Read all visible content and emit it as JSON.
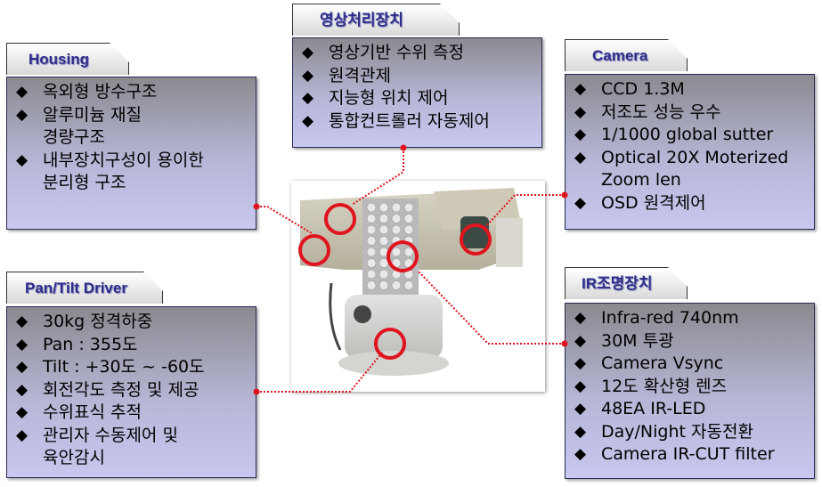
{
  "sections": {
    "housing": {
      "title": "Housing",
      "items": [
        "옥외형 방수구조",
        "알루미늄 재질\n경량구조",
        "내부장치구성이 용이한\n분리형 구조"
      ]
    },
    "image_processor": {
      "title": "영상처리장치",
      "items": [
        "영상기반 수위 측정",
        "원격관제",
        "지능형 위치 제어",
        "통합컨트롤러 자동제어"
      ]
    },
    "camera": {
      "title": "Camera",
      "items": [
        "CCD 1.3M",
        "저조도 성능 우수",
        "1/1000 global sutter",
        "Optical 20X Moterized\nZoom len",
        "OSD 원격제어"
      ]
    },
    "pan_tilt": {
      "title": "Pan/Tilt Driver",
      "items": [
        "30kg 정격하중",
        "Pan : 355도",
        "Tilt : +30도 ~ -60도",
        "회전각도 측정 및 제공",
        "수위표식 추적",
        "관리자 수동제어 및\n육안감시"
      ]
    },
    "ir_light": {
      "title": "IR조명장치",
      "items": [
        "Infra-red 740nm",
        "30M 투광",
        "Camera Vsync",
        "12도 확산형 렌즈",
        "48EA IR-LED",
        "Day/Night 자동전환",
        "Camera IR-CUT filter"
      ]
    }
  },
  "bullet": "◆",
  "colors": {
    "highlight": "#e0141e",
    "title_text": "#2d2d8a",
    "box_border": "#2a2a55"
  }
}
